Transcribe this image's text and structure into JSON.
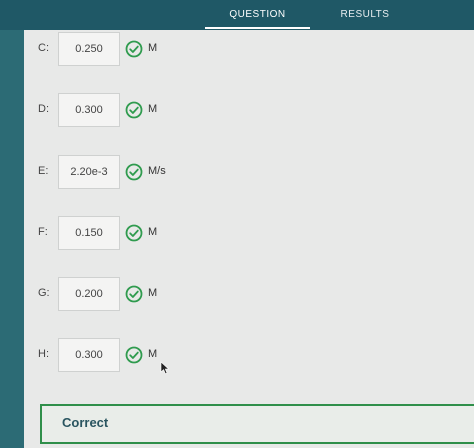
{
  "tabs": {
    "question": "QUESTION",
    "results": "RESULTS"
  },
  "answers": [
    {
      "label": "C:",
      "value": "0.250",
      "unit": "M"
    },
    {
      "label": "D:",
      "value": "0.300",
      "unit": "M"
    },
    {
      "label": "E:",
      "value": "2.20e-3",
      "unit": "M/s"
    },
    {
      "label": "F:",
      "value": "0.150",
      "unit": "M"
    },
    {
      "label": "G:",
      "value": "0.200",
      "unit": "M"
    },
    {
      "label": "H:",
      "value": "0.300",
      "unit": "M"
    }
  ],
  "feedback": {
    "text": "Correct"
  },
  "icons": {
    "check": "check-circle-icon",
    "cursor": "mouse-pointer-icon"
  },
  "colors": {
    "check_green": "#2f9b4e",
    "feedback_border": "#2f8f4a",
    "header": "#1f5866"
  }
}
